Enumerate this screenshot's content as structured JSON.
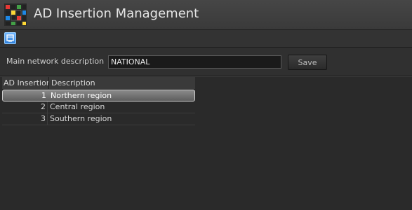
{
  "window": {
    "title": "AD Insertion Management",
    "logo_icon": "checkered-grid-logo-icon"
  },
  "toolbar": {
    "items": [
      {
        "icon": "app-tool-icon"
      }
    ]
  },
  "form": {
    "network_label": "Main network description",
    "network_value": "NATIONAL",
    "save_label": "Save"
  },
  "grid": {
    "columns": [
      "AD Insertion",
      "Description"
    ],
    "rows": [
      {
        "id": "1",
        "description": "Northern region",
        "selected": true
      },
      {
        "id": "2",
        "description": "Central region",
        "selected": false
      },
      {
        "id": "3",
        "description": "Southern region",
        "selected": false
      }
    ]
  },
  "colors": {
    "background": "#2b2b2b",
    "titlebar": "#3a3a3a",
    "selection": "#7a7a7a",
    "tool_button": "#3f95f0"
  }
}
